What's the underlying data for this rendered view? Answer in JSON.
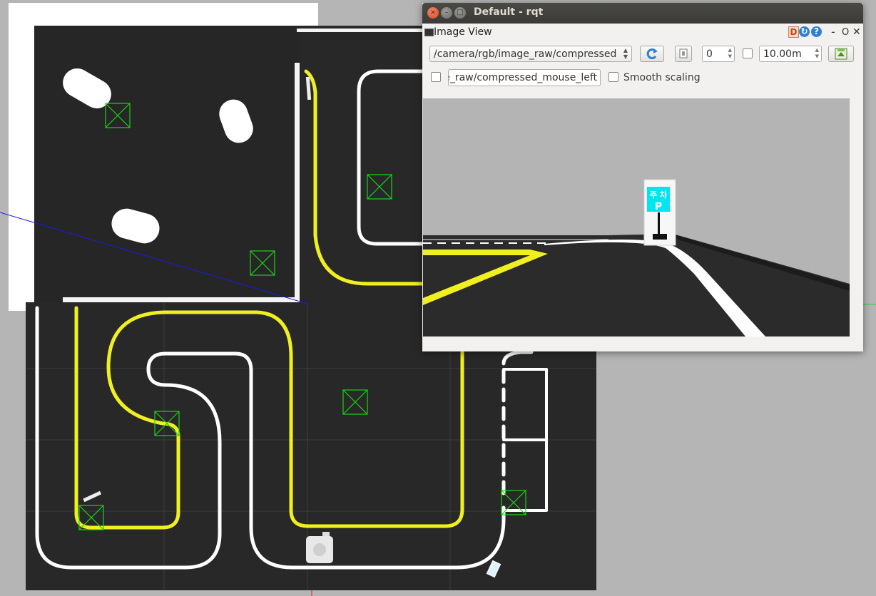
{
  "window": {
    "title": "Default - rqt",
    "controls": {
      "close": "×",
      "minimize": "–",
      "maximize": "□"
    }
  },
  "plugin": {
    "title": "Image View",
    "title_buttons": {
      "d": "D",
      "reload": "↻",
      "help": "?",
      "dash": "-",
      "o": "O",
      "close": "✕"
    }
  },
  "toolbar": {
    "topic": "/camera/rgb/image_raw/compressed",
    "refresh_icon": "refresh-icon",
    "zoom_icon": "zoom-fit-icon",
    "rotation": "0",
    "max_range": "10.00m",
    "save_icon": "save-image-icon"
  },
  "options": {
    "mouse_topic": "/camera/rgb/image_raw/compressed_mouse_left",
    "smooth_label": "Smooth scaling"
  },
  "camera": {
    "sign_line1": "주 차",
    "sign_line2": "P",
    "sign_color": "#00e6ee"
  },
  "colors": {
    "track_lane": "#f0f020",
    "track_border": "#ffffff",
    "floor": "#262626",
    "target_marker": "#19d119",
    "background": "#b5b5b5"
  }
}
